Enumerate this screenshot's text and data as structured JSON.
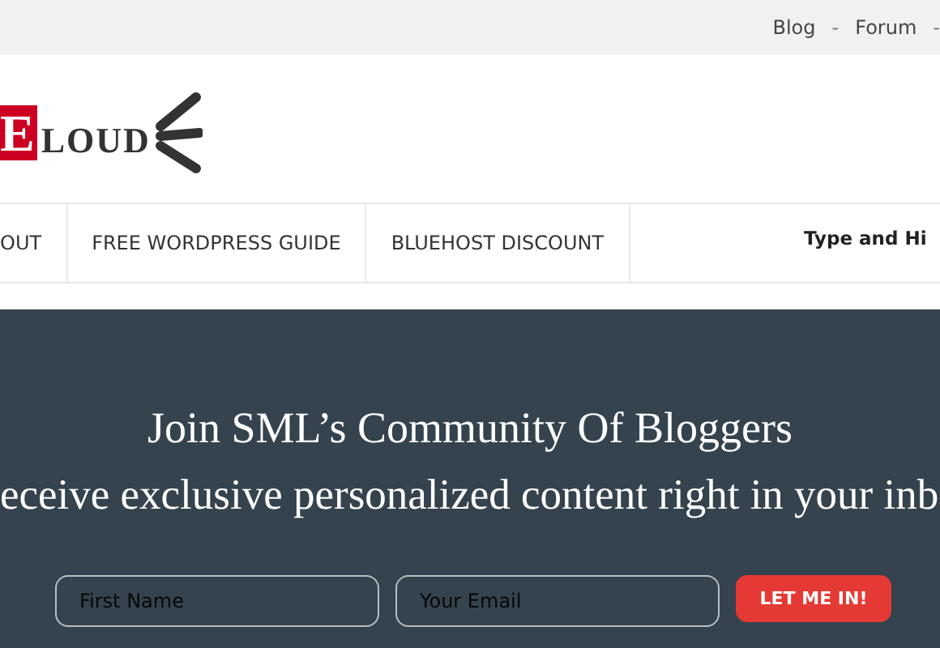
{
  "top_links": [
    {
      "kind": "link",
      "text": "Blog"
    },
    {
      "kind": "separator",
      "text": "-"
    },
    {
      "kind": "link",
      "text": "Forum"
    },
    {
      "kind": "separator",
      "text": "-"
    }
  ],
  "logo": {
    "mark": "E",
    "word": "LOUD"
  },
  "nav": {
    "items": [
      {
        "label": "OUT"
      },
      {
        "label": "FREE WORDPRESS GUIDE"
      },
      {
        "label": "BLUEHOST DISCOUNT"
      }
    ],
    "search": {
      "placeholder": "Type and Hi"
    }
  },
  "signup": {
    "title": "Join SML’s Community Of Bloggers",
    "subtitle": "eceive exclusive personalized content right in your inb",
    "fields": [
      {
        "placeholder": "First Name"
      },
      {
        "placeholder": "Your Email"
      }
    ],
    "button": "LET ME IN!"
  }
}
